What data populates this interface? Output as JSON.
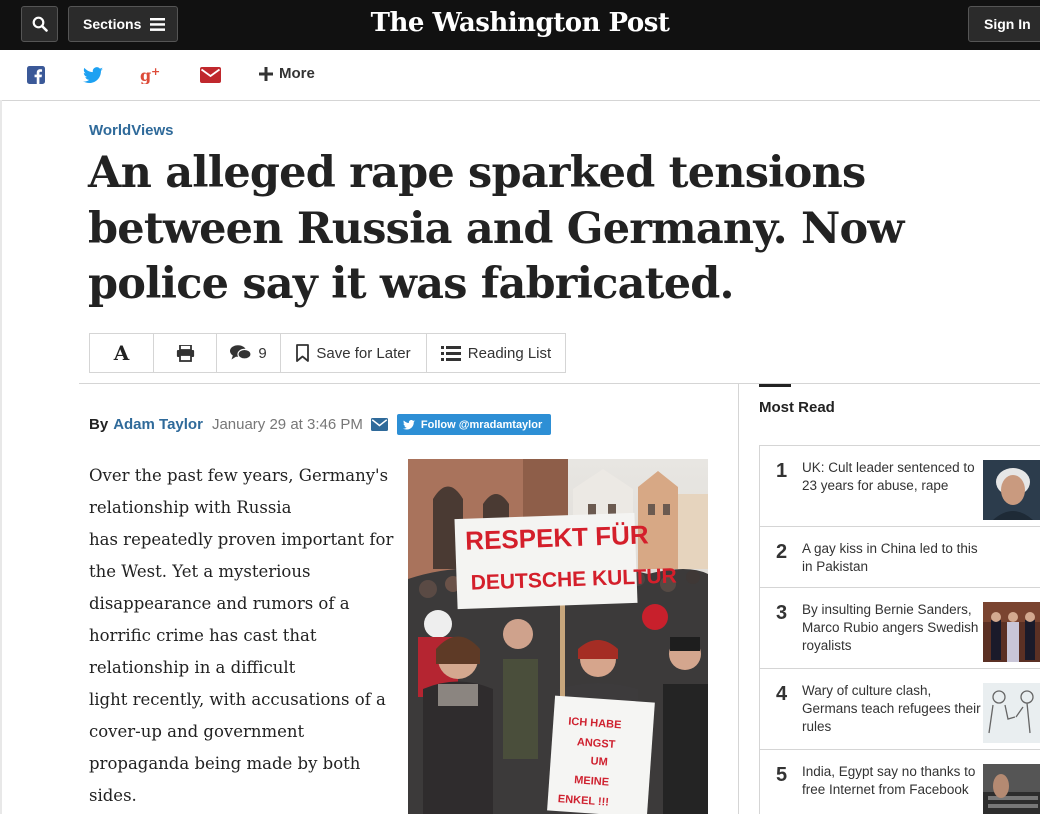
{
  "topbar": {
    "sections_label": "Sections",
    "logo_text": "The Washington Post",
    "signin_label": "Sign In"
  },
  "sharebar": {
    "more_label": "More",
    "icons": [
      "facebook-icon",
      "twitter-icon",
      "google-plus-icon",
      "email-icon"
    ],
    "colors": {
      "facebook": "#3b5998",
      "twitter": "#1da1f2",
      "google_plus": "#dd4b39",
      "email": "#c0282d"
    }
  },
  "article": {
    "kicker": "WorldViews",
    "headline": "An alleged rape sparked tensions between Russia and Germany. Now police say it was fabricated.",
    "tools": {
      "font_label": "A",
      "comments_count": "9",
      "save_label": "Save for Later",
      "reading_list_label": "Reading List"
    },
    "byline": {
      "by": "By",
      "author": "Adam Taylor",
      "date": "January 29 at 3:46 PM",
      "follow_label": "Follow @mradamtaylor"
    },
    "body_lines": [
      "Over the past few years, Germany's",
      "relationship with Russia",
      "has repeatedly proven important for",
      "the West. Yet a mysterious",
      "disappearance and rumors of a",
      "horrific crime has cast that",
      "relationship in a difficult",
      "light recently, with accusations of a",
      "cover-up and government",
      "propaganda being made by both",
      "sides."
    ],
    "photo": {
      "sign_1": [
        "RESPEKT FÜR",
        "DEUTSCHE KULTUR"
      ],
      "sign_2": [
        "ICH HABE",
        "ANGST",
        "UM",
        "MEINE",
        "ENKEL !!!"
      ]
    }
  },
  "most_read": {
    "title": "Most Read",
    "items": [
      {
        "num": "1",
        "text": "UK: Cult leader sentenced to 23 years for abuse, rape"
      },
      {
        "num": "2",
        "text": "A gay kiss in China led to this in Pakistan"
      },
      {
        "num": "3",
        "text": "By insulting Bernie Sanders, Marco Rubio angers Swedish royalists"
      },
      {
        "num": "4",
        "text": "Wary of culture clash, Germans teach refugees their rules"
      },
      {
        "num": "5",
        "text": "India, Egypt say no thanks to free Internet from Facebook"
      }
    ]
  },
  "colors": {
    "link_blue": "#2f6a9a",
    "topbar": "#111111",
    "twitter_button": "#2d8fd5"
  }
}
